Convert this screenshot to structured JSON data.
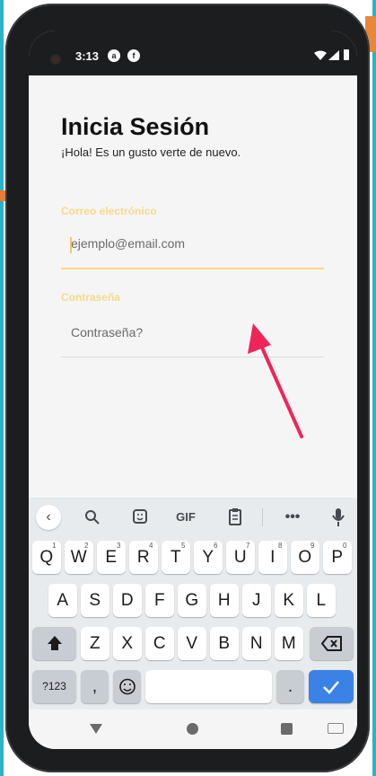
{
  "status_bar": {
    "time": "3:13",
    "notif_icons": [
      "a",
      "f"
    ],
    "icons": [
      "wifi-icon",
      "signal-icon",
      "battery-icon"
    ]
  },
  "login": {
    "title": "Inicia Sesión",
    "subtitle": "¡Hola! Es un gusto verte de nuevo.",
    "email_label": "Correo electrónico",
    "email_placeholder": "ejemplo@email.com",
    "password_label": "Contraseña",
    "password_placeholder": "Contraseña?"
  },
  "colors": {
    "accent": "#f7d98a",
    "arrow": "#f0245a",
    "keyboard_bg": "#e8ebee",
    "enter_key": "#3b82e6"
  },
  "keyboard": {
    "toolbar": [
      "chevron-left-icon",
      "search-icon",
      "sticker-icon",
      "GIF",
      "clipboard-icon",
      "more-icon",
      "mic-icon"
    ],
    "gif_label": "GIF",
    "row1": [
      {
        "k": "Q",
        "h": "1"
      },
      {
        "k": "W",
        "h": "2"
      },
      {
        "k": "E",
        "h": "3"
      },
      {
        "k": "R",
        "h": "4"
      },
      {
        "k": "T",
        "h": "5"
      },
      {
        "k": "Y",
        "h": "6"
      },
      {
        "k": "U",
        "h": "7"
      },
      {
        "k": "I",
        "h": "8"
      },
      {
        "k": "O",
        "h": "9"
      },
      {
        "k": "P",
        "h": "0"
      }
    ],
    "row2": [
      "A",
      "S",
      "D",
      "F",
      "G",
      "H",
      "J",
      "K",
      "L"
    ],
    "row3": [
      "Z",
      "X",
      "C",
      "V",
      "B",
      "N",
      "M"
    ],
    "symbols_label": "?123",
    "comma": ",",
    "period": "."
  }
}
